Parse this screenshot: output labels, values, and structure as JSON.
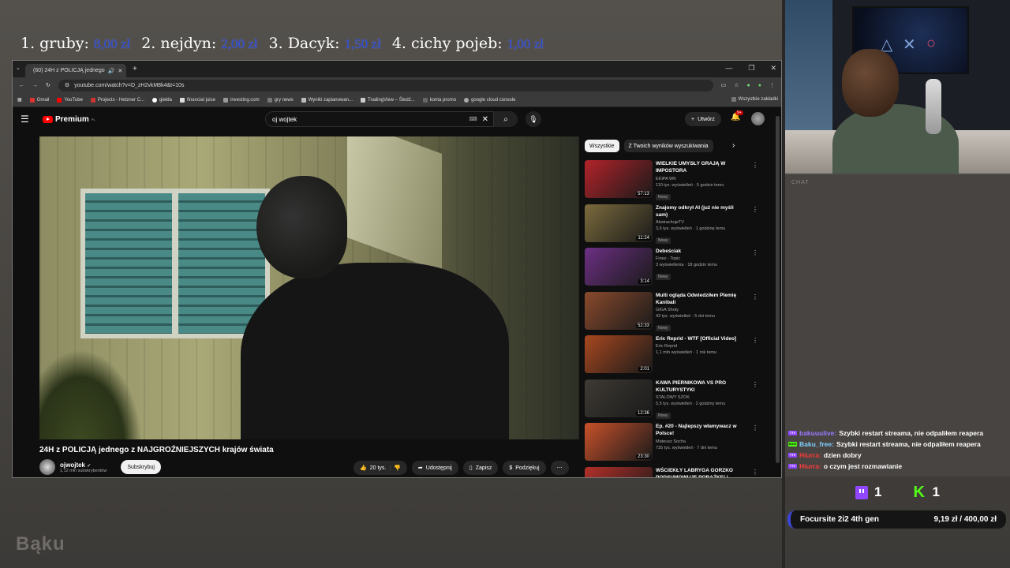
{
  "donors": [
    {
      "rank": "1.",
      "name": "gruby:",
      "amount": "8,00 zł"
    },
    {
      "rank": "2.",
      "name": "nejdyn:",
      "amount": "2,00 zł"
    },
    {
      "rank": "3.",
      "name": "Dacyk:",
      "amount": "1,50 zł"
    },
    {
      "rank": "4.",
      "name": "cichy pojeb:",
      "amount": "1,00 zł"
    }
  ],
  "browser": {
    "tab_title": "(60) 24H z POLICJĄ jednego",
    "url": "youtube.com/watch?v=D_zH2vkM8k4&t=10s",
    "bookmarks": [
      "Gmail",
      "YouTube",
      "Projects - Hetzner C...",
      "giełda",
      "financial juice",
      "investing.com",
      "gry news",
      "Wyniki zaplanowan...",
      "TradingView – Śledź...",
      "konta promo",
      "google cloud console"
    ],
    "all_bookmarks": "Wszystkie zakładki"
  },
  "youtube": {
    "logo": "Premium",
    "logo_region": "PL",
    "search_value": "oj wojtek",
    "create_label": "Utwórz",
    "bell_badge": "9+",
    "video_title": "24H z POLICJĄ jednego z NAJGROŹNIEJSZYCH krajów świata",
    "channel": "ojwojtek",
    "subscribers": "1,12 mln subskrybentów",
    "subscribe_label": "Subskrybuj",
    "likes": "20 tys.",
    "share_label": "Udostępnij",
    "save_label": "Zapisz",
    "thanks_label": "Podziękuj",
    "chips": [
      "Wszystkie",
      "Z Twoich wyników wyszukiwania"
    ],
    "recommended": [
      {
        "title": "WIELKIE UMYSŁY GRAJĄ W IMPOSTORA",
        "channel": "EKIPA WK",
        "meta": "110 tys. wyświetleń · 5 godzin temu",
        "duration": "57:13",
        "new": "Nowy",
        "color": "#b3232a"
      },
      {
        "title": "Znajomy odkrył AI (już nie myśli sam)",
        "channel": "AbstrachujeTV",
        "meta": "3,6 tys. wyświetleń · 1 godzinę temu",
        "duration": "11:24",
        "new": "Nowy",
        "color": "#7c6b3d"
      },
      {
        "title": "Debeściak",
        "channel": "Finez - Topic",
        "meta": "3 wyświetlenia · 18 godzin temu",
        "duration": "3:14",
        "new": "Nowy",
        "color": "#6c2f83"
      },
      {
        "title": "Multi ogląda Odwiedziłem Plemię Kanibali",
        "channel": "GIGA Shoty",
        "meta": "43 tys. wyświetleń · 5 dni temu",
        "duration": "52:33",
        "new": "Nowy",
        "color": "#8a4a2c"
      },
      {
        "title": "Eric Reprid - WTF [Official Video]",
        "channel": "Eric Reprid",
        "meta": "1,1 mln wyświetleń · 1 rok temu",
        "duration": "2:01",
        "new": "",
        "color": "#a8481f"
      },
      {
        "title": "KAWA PIERNIKOWA VS PRO KULTURYSTYKI",
        "channel": "STALOWY SZOK",
        "meta": "5,5 tys. wyświetleń · 2 godziny temu",
        "duration": "12:36",
        "new": "Nowy",
        "color": "#3e3a34"
      },
      {
        "title": "Ep. #20 - Najlepszy włamywacz w Polsce!",
        "channel": "Mateusz Socha",
        "meta": "735 tys. wyświetleń · 7 dni temu",
        "duration": "23:30",
        "new": "",
        "color": "#c8512a"
      },
      {
        "title": "WŚCIEKŁY LABRYGA GORZKO PODSUMOWUJE PORAŻKĘ! | ...",
        "channel": "",
        "meta": "",
        "duration": "",
        "new": "",
        "color": "#b32f28"
      }
    ]
  },
  "chat": {
    "label": "CHAT",
    "messages": [
      {
        "platform": "TTV",
        "platform_color": "#9146ff",
        "user": "bakuuulive:",
        "text": "Szybki restart streama, nie odpaliłem reapera"
      },
      {
        "platform": "KICK",
        "platform_color": "#53fc18",
        "user": "Baku_free:",
        "text": "Szybki restart streama, nie odpaliłem reapera"
      },
      {
        "platform": "TTV",
        "platform_color": "#9146ff",
        "user": "Hiurra:",
        "text": "dzien dobry"
      },
      {
        "platform": "TTV",
        "platform_color": "#9146ff",
        "user": "Hiurra:",
        "text": "o czym jest rozmawianie"
      }
    ]
  },
  "viewers": {
    "twitch": "1",
    "kick": "1"
  },
  "goal": {
    "label": "Focursite 2i2 4th gen",
    "progress": "9,19 zł / 400,00 zł",
    "progress_fraction": 0.023
  },
  "brand": "Bąku",
  "accent_colors": {
    "twitch": "#9146ff",
    "kick": "#53fc18",
    "donation_amount": "#2b46c9",
    "youtube_red": "#ff0000"
  }
}
